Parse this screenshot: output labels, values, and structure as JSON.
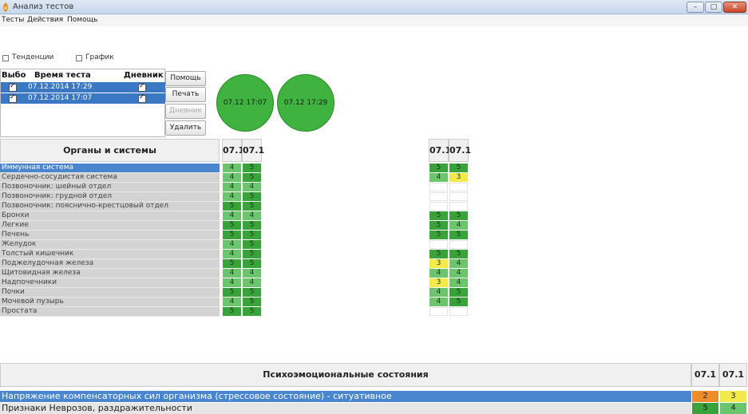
{
  "window": {
    "title": "Анализ тестов"
  },
  "menu": [
    "Тесты",
    "Действия",
    "Помощь"
  ],
  "options": {
    "trends": "Тенденции",
    "graph": "График"
  },
  "tests_table": {
    "headers": [
      "Выбо",
      "Время теста",
      "Дневник"
    ],
    "rows": [
      {
        "selected": true,
        "time": "07.12.2014 17:29",
        "diary": true
      },
      {
        "selected": true,
        "time": "07.12.2014 17:07",
        "diary": true
      }
    ]
  },
  "buttons": {
    "help": "Помощь",
    "print": "Печать",
    "diary": "Дневник",
    "delete": "Удалить"
  },
  "circles": [
    "07.12 17:07",
    "07.12 17:29"
  ],
  "organs": {
    "header": "Органы и системы",
    "col_headers": [
      "07.1",
      "07.1"
    ],
    "right_col_headers": [
      "07.1",
      "07.1"
    ],
    "rows": [
      {
        "name": "Иммунная система",
        "v": [
          "4",
          "5"
        ],
        "r": [
          "5",
          "5"
        ]
      },
      {
        "name": "Сердечно-сосудистая система",
        "v": [
          "4",
          "5"
        ],
        "r": [
          "4",
          "3"
        ]
      },
      {
        "name": "Позвоночник: шейный отдел",
        "v": [
          "4",
          "4"
        ],
        "r": [
          "",
          ""
        ]
      },
      {
        "name": "Позвоночник: грудной отдел",
        "v": [
          "4",
          "5"
        ],
        "r": [
          "",
          ""
        ]
      },
      {
        "name": "Позвоночник: пояснично-крестцовый отдел",
        "v": [
          "5",
          "5"
        ],
        "r": [
          "",
          ""
        ]
      },
      {
        "name": "Бронхи",
        "v": [
          "4",
          "4"
        ],
        "r": [
          "5",
          "5"
        ]
      },
      {
        "name": "Легкие",
        "v": [
          "5",
          "5"
        ],
        "r": [
          "5",
          "4"
        ]
      },
      {
        "name": "Печень",
        "v": [
          "5",
          "5"
        ],
        "r": [
          "5",
          "5"
        ]
      },
      {
        "name": "Желудок",
        "v": [
          "4",
          "5"
        ],
        "r": [
          "",
          ""
        ]
      },
      {
        "name": "Толстый кишечник",
        "v": [
          "4",
          "5"
        ],
        "r": [
          "5",
          "5"
        ]
      },
      {
        "name": "Поджелудочная железа",
        "v": [
          "5",
          "5"
        ],
        "r": [
          "3",
          "4"
        ]
      },
      {
        "name": "Щитовидная железа",
        "v": [
          "4",
          "4"
        ],
        "r": [
          "4",
          "4"
        ]
      },
      {
        "name": "Надпочечники",
        "v": [
          "4",
          "4"
        ],
        "r": [
          "3",
          "4"
        ]
      },
      {
        "name": "Почки",
        "v": [
          "5",
          "5"
        ],
        "r": [
          "4",
          "5"
        ]
      },
      {
        "name": "Мочевой пузырь",
        "v": [
          "4",
          "5"
        ],
        "r": [
          "4",
          "5"
        ]
      },
      {
        "name": "Простата",
        "v": [
          "5",
          "5"
        ],
        "r": [
          "",
          ""
        ]
      }
    ]
  },
  "psycho": {
    "header": "Психоэмоциональные состояния",
    "col_headers": [
      "07.1",
      "07.1"
    ],
    "rows": [
      {
        "name": "Напряжение компенсаторных сил организма (стрессовое состояние) - ситуативное",
        "v": [
          "2",
          "3"
        ]
      },
      {
        "name": "Признаки Неврозов, раздражительности",
        "v": [
          "5",
          "4"
        ]
      }
    ]
  },
  "colors": {
    "green": "#6cc46c",
    "dark_green": "#3aa23a",
    "yellow": "#f2ea4a",
    "orange": "#ee8c2a",
    "selection": "#4a86d0"
  }
}
